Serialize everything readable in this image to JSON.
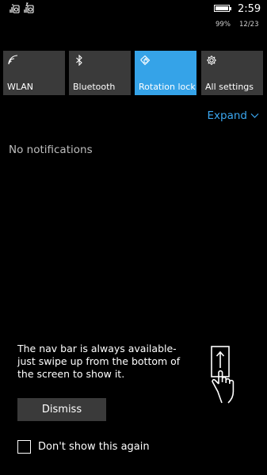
{
  "status_bar": {
    "time": "2:59",
    "battery_percent": "99%",
    "date": "12/23",
    "icons": [
      "sim-1-signal-icon",
      "sim-2-signal-icon",
      "battery-icon"
    ]
  },
  "quick_actions": [
    {
      "label": "WLAN",
      "icon": "wifi-icon",
      "active": false
    },
    {
      "label": "Bluetooth",
      "icon": "bluetooth-icon",
      "active": false
    },
    {
      "label": "Rotation lock",
      "icon": "rotation-lock-icon",
      "active": true
    },
    {
      "label": "All settings",
      "icon": "gear-icon",
      "active": false
    }
  ],
  "expand": {
    "label": "Expand",
    "icon": "chevron-down-icon"
  },
  "notifications": {
    "empty_text": "No notifications"
  },
  "nav_tip": {
    "message": "The nav bar is always available-just swipe up from the bottom of the screen to show it.",
    "icon": "swipe-up-hand-icon",
    "dismiss_label": "Dismiss",
    "checkbox_label": "Don't show this again",
    "checkbox_checked": false
  },
  "colors": {
    "accent": "#35a3e8",
    "tile": "#3a3a3a",
    "background": "#000000",
    "link": "#3aa6ef"
  }
}
